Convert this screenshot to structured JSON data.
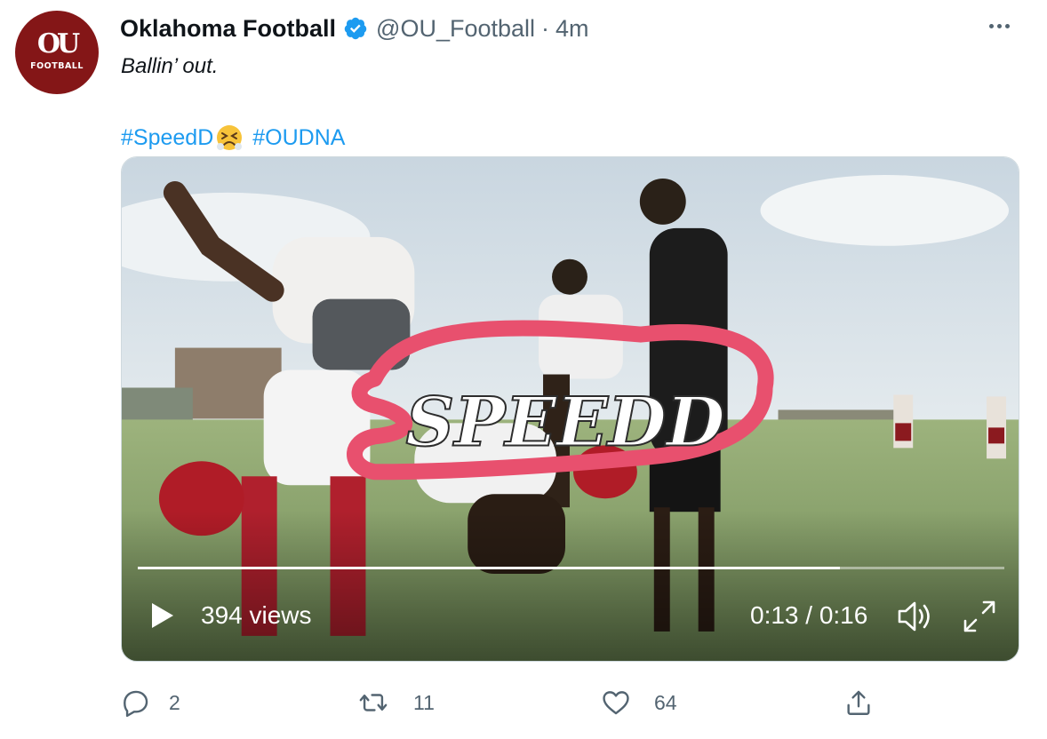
{
  "tweet": {
    "avatar": {
      "monogram": "OU",
      "wordmark": "FOOTBALL"
    },
    "author_name": "Oklahoma Football",
    "handle": "@OU_Football",
    "separator": "·",
    "timestamp": "4m",
    "text": "Ballin’ out.",
    "hashtags": [
      "#SpeedD",
      "#OUDNA"
    ],
    "emoji": "persevering-face"
  },
  "video": {
    "overlay_logo": "SPEEDD",
    "views": "394 views",
    "timecode": "0:13 / 0:16",
    "progress": 0.81
  },
  "actions": {
    "reply_count": "2",
    "retweet_count": "11",
    "like_count": "64"
  },
  "colors": {
    "link": "#1d9bf0",
    "secondary_text": "#536471",
    "brand_crimson": "#841617",
    "speedd_pink": "#e8506e"
  }
}
